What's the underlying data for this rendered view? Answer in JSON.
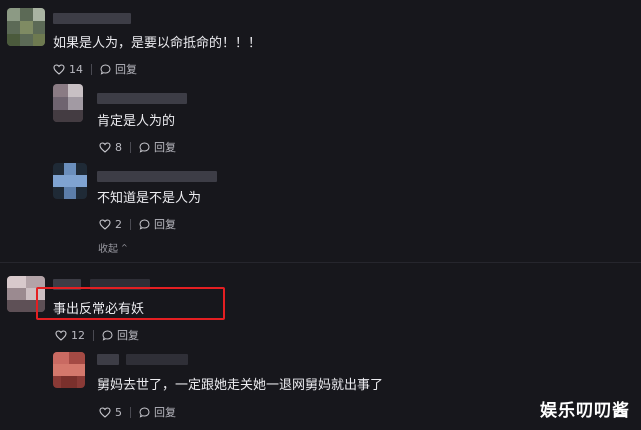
{
  "comments": [
    {
      "text": "如果是人为，是要以命抵命的！！！",
      "likes": "14",
      "reply_label": "回复",
      "replies": [
        {
          "text": "肯定是人为的",
          "likes": "8",
          "reply_label": "回复"
        },
        {
          "text": "不知道是不是人为",
          "likes": "2",
          "reply_label": "回复"
        }
      ],
      "collapse_label": "收起",
      "collapse_arrow": "^"
    },
    {
      "text": "事出反常必有妖",
      "likes": "12",
      "reply_label": "回复",
      "highlight_color": "#e41f22",
      "replies": [
        {
          "text": "舅妈去世了，一定跟她走关她一退网舅妈就出事了",
          "likes": "5",
          "reply_label": "回复"
        }
      ]
    }
  ],
  "watermark": "娱乐叨叨酱",
  "icons": {
    "like": "heart-outline-icon",
    "reply": "speech-bubble-icon"
  },
  "colors": {
    "background": "#17171c",
    "text": "#ececf0",
    "muted": "#b9b9c0",
    "highlight": "#e41f22"
  }
}
